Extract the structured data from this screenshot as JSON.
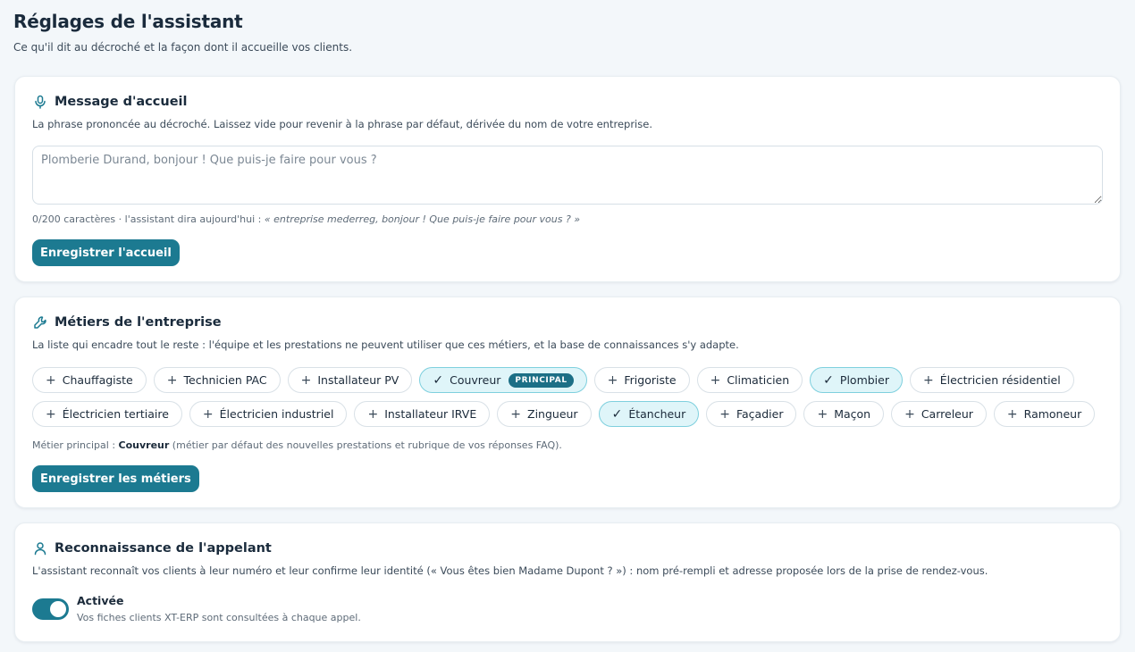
{
  "page": {
    "title": "Réglages de l'assistant",
    "subtitle": "Ce qu'il dit au décroché et la façon dont il accueille vos clients."
  },
  "greeting": {
    "title": "Message d'accueil",
    "icon": "microphone-icon",
    "description": "La phrase prononcée au décroché. Laissez vide pour revenir à la phrase par défaut, dérivée du nom de votre entreprise.",
    "value": "",
    "placeholder": "Plomberie Durand, bonjour ! Que puis-je faire pour vous ?",
    "counter": "0/200 caractères · l'assistant dira aujourd'hui : ",
    "preview": "« entreprise mederreg, bonjour ! Que puis-je faire pour vous ? »",
    "save_label": "Enregistrer l'accueil"
  },
  "trades": {
    "title": "Métiers de l'entreprise",
    "icon": "wrench-icon",
    "description": "La liste qui encadre tout le reste : l'équipe et les prestations ne peuvent utiliser que ces métiers, et la base de connaissances s'y adapte.",
    "principal_badge": "PRINCIPAL",
    "row1": [
      {
        "label": "Chauffagiste",
        "selected": false
      },
      {
        "label": "Technicien PAC",
        "selected": false
      },
      {
        "label": "Installateur PV",
        "selected": false
      },
      {
        "label": "Couvreur",
        "selected": true,
        "principal": true
      },
      {
        "label": "Frigoriste",
        "selected": false
      },
      {
        "label": "Climaticien",
        "selected": false
      },
      {
        "label": "Plombier",
        "selected": true
      },
      {
        "label": "Électricien résidentiel",
        "selected": false
      }
    ],
    "row2": [
      {
        "label": "Électricien tertiaire",
        "selected": false
      },
      {
        "label": "Électricien industriel",
        "selected": false
      },
      {
        "label": "Installateur IRVE",
        "selected": false
      },
      {
        "label": "Zingueur",
        "selected": false
      },
      {
        "label": "Étancheur",
        "selected": true
      },
      {
        "label": "Façadier",
        "selected": false
      },
      {
        "label": "Maçon",
        "selected": false
      },
      {
        "label": "Carreleur",
        "selected": false
      },
      {
        "label": "Ramoneur",
        "selected": false
      }
    ],
    "note_prefix": "Métier principal : ",
    "note_main": "Couvreur",
    "note_suffix": " (métier par défaut des nouvelles prestations et rubrique de vos réponses FAQ).",
    "save_label": "Enregistrer les métiers"
  },
  "caller": {
    "title": "Reconnaissance de l'appelant",
    "icon": "user-icon",
    "description": "L'assistant reconnaît vos clients à leur numéro et leur confirme leur identité (« Vous êtes bien Madame Dupont ? ») : nom pré-rempli et adresse proposée lors de la prise de rendez-vous.",
    "toggle_on": true,
    "toggle_label": "Activée",
    "toggle_help": "Vos fiches clients XT-ERP sont consultées à chaque appel."
  },
  "colors": {
    "accent": "#1c7a91",
    "chip_selected_bg": "#dff5f9",
    "chip_selected_border": "#7fd0de",
    "background": "#f3f7fa"
  }
}
